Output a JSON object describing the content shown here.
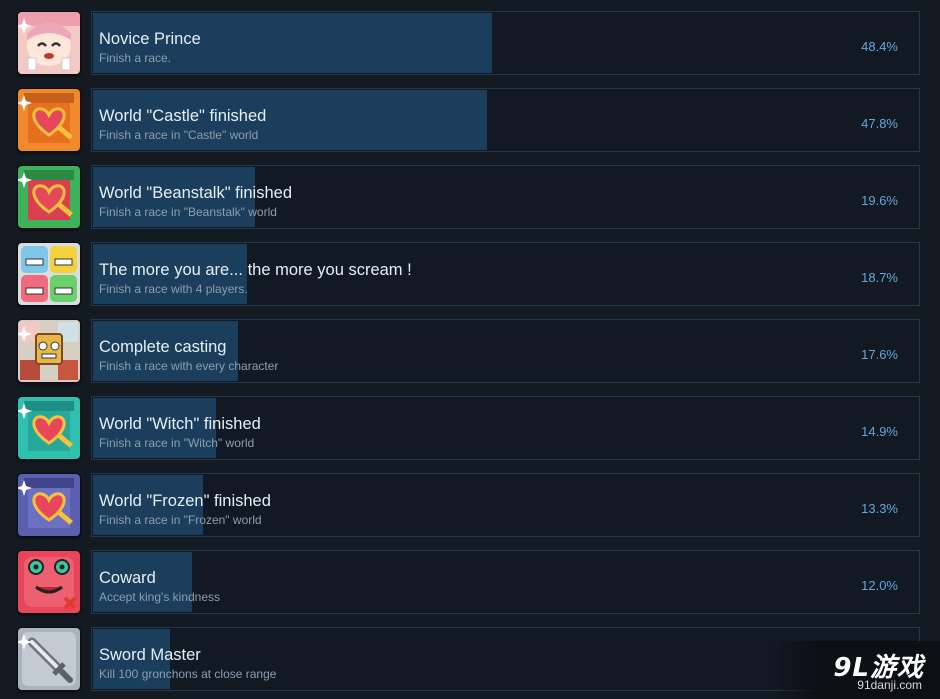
{
  "achievements": [
    {
      "title": "Novice Prince",
      "description": "Finish a race.",
      "percent_label": "48.4%",
      "percent": 48.4,
      "icon": "novice-prince-icon"
    },
    {
      "title": "World \"Castle\" finished",
      "description": "Finish a race in \"Castle\" world",
      "percent_label": "47.8%",
      "percent": 47.8,
      "icon": "castle-key-icon"
    },
    {
      "title": "World \"Beanstalk\" finished",
      "description": "Finish a race in \"Beanstalk\" world",
      "percent_label": "19.6%",
      "percent": 19.6,
      "icon": "beanstalk-key-icon"
    },
    {
      "title": "The more you are... the more you scream !",
      "description": "Finish a race with 4 players.",
      "percent_label": "18.7%",
      "percent": 18.7,
      "icon": "four-players-icon"
    },
    {
      "title": "Complete casting",
      "description": "Finish a race with every character",
      "percent_label": "17.6%",
      "percent": 17.6,
      "icon": "characters-icon"
    },
    {
      "title": "World \"Witch\" finished",
      "description": "Finish a race in \"Witch\" world",
      "percent_label": "14.9%",
      "percent": 14.9,
      "icon": "witch-key-icon"
    },
    {
      "title": "World \"Frozen\" finished",
      "description": "Finish a race in \"Frozen\" world",
      "percent_label": "13.3%",
      "percent": 13.3,
      "icon": "frozen-key-icon"
    },
    {
      "title": "Coward",
      "description": "Accept king's kindness",
      "percent_label": "12.0%",
      "percent": 12.0,
      "icon": "coward-frog-icon"
    },
    {
      "title": "Sword Master",
      "description": "Kill 100 gronchons at close range",
      "percent_label": "",
      "percent": 9.3,
      "icon": "sword-icon"
    }
  ],
  "watermark": {
    "logo": "9L游戏",
    "url": "91danji.com"
  },
  "colors": {
    "bar": "#1a3e5b",
    "percent_text": "#5fa9e0",
    "card_border": "#24384d",
    "background": "#141a22"
  }
}
